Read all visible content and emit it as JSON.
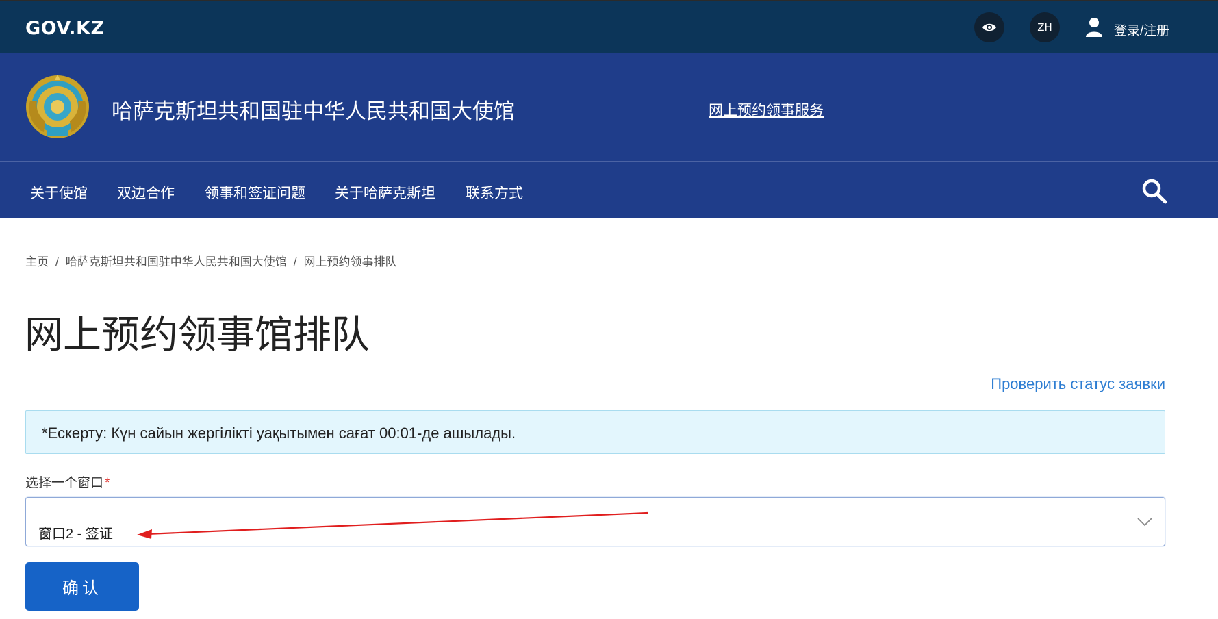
{
  "topbar": {
    "logo": "GOV.KZ",
    "language": "ZH",
    "login_label": "登录/注册",
    "background": "#0c3559"
  },
  "brand": {
    "embassy_title": "哈萨克斯坦共和国驻中华人民共和国大使馆",
    "online_service_link": "网上预约领事服务",
    "background": "#1f3d8a"
  },
  "nav": {
    "items": [
      {
        "label": "关于使馆"
      },
      {
        "label": "双边合作"
      },
      {
        "label": "领事和签证问题"
      },
      {
        "label": "关于哈萨克斯坦"
      },
      {
        "label": "联系方式"
      }
    ]
  },
  "breadcrumb": {
    "items": [
      {
        "label": "主页"
      },
      {
        "label": "哈萨克斯坦共和国驻中华人民共和国大使馆"
      },
      {
        "label": "网上预约领事排队"
      }
    ],
    "separator": "/"
  },
  "main": {
    "title": "网上预约领事馆排队",
    "status_link": "Проверить статус заявки",
    "notice": "*Ескерту: Күн сайын жергілікті уақытымен сағат 00:01-де ашылады.",
    "select_label": "选择一个窗口",
    "required_mark": "*",
    "select_value": "窗口2 - 签证",
    "confirm_label": "确认"
  },
  "colors": {
    "accent": "#1663c7",
    "link": "#2d7dd2",
    "notice_bg": "#e3f6fd",
    "annotation_arrow": "#e01e1e"
  }
}
